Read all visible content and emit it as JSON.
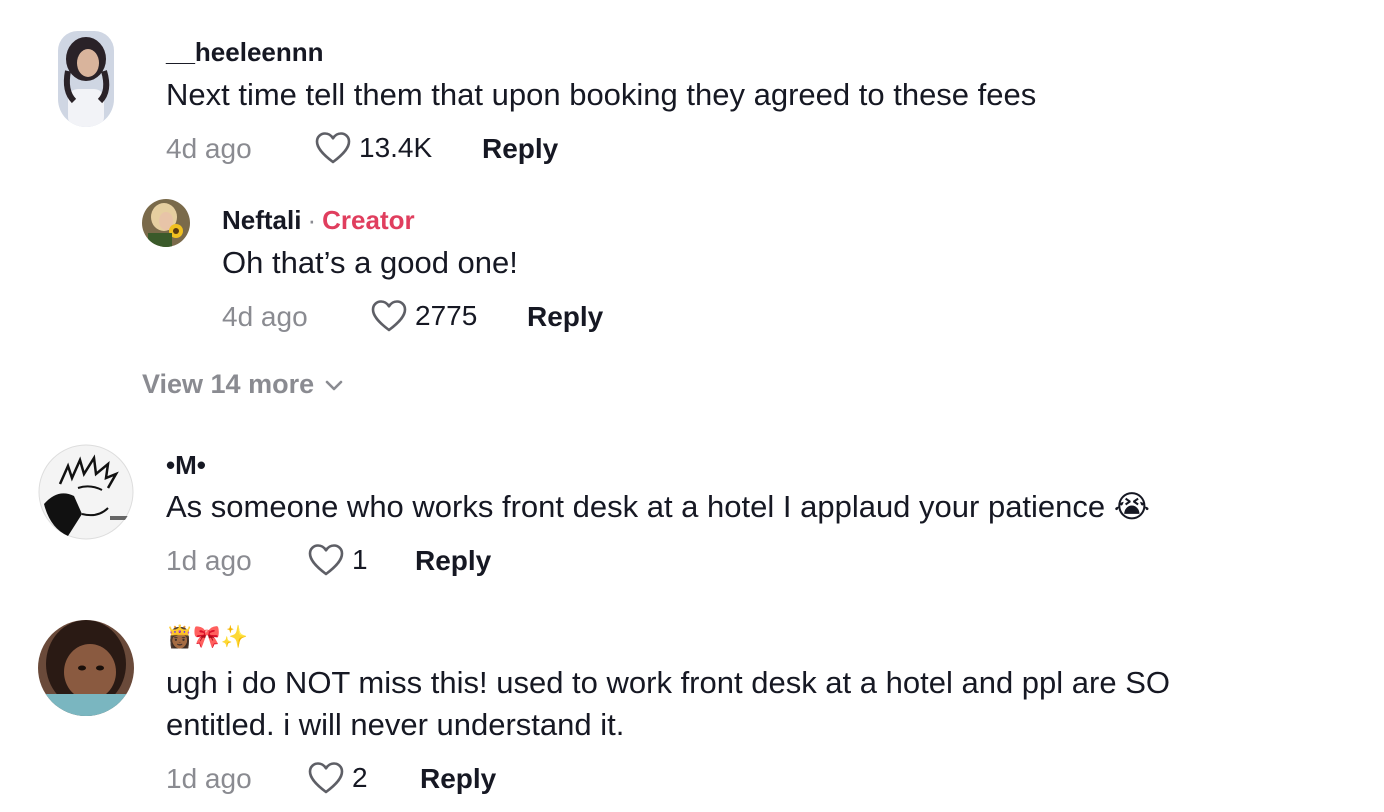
{
  "comments": [
    {
      "username": "__heeleennn",
      "text": "Next time tell them that upon booking they agreed to these fees",
      "time": "4d ago",
      "likes": "13.4K",
      "reply_label": "Reply"
    },
    {
      "username": "Neftali",
      "separator": "·",
      "badge": "Creator",
      "text": "Oh that’s a good one!",
      "time": "4d ago",
      "likes": "2775",
      "reply_label": "Reply"
    },
    {
      "username": "•M•",
      "text": "As someone who works front desk at a hotel I applaud your patience 😭",
      "time": "1d ago",
      "likes": "1",
      "reply_label": "Reply"
    },
    {
      "username": "👸🏾🎀✨",
      "text_line1": "ugh i do NOT miss this! used to work front desk at a hotel and ppl are SO",
      "text_line2": "entitled. i will never understand it.",
      "time": "1d ago",
      "likes": "2",
      "reply_label": "Reply"
    }
  ],
  "view_more": "View 14 more",
  "colors": {
    "text": "#161823",
    "muted": "#8a8b91",
    "creator": "#e03e5e"
  }
}
